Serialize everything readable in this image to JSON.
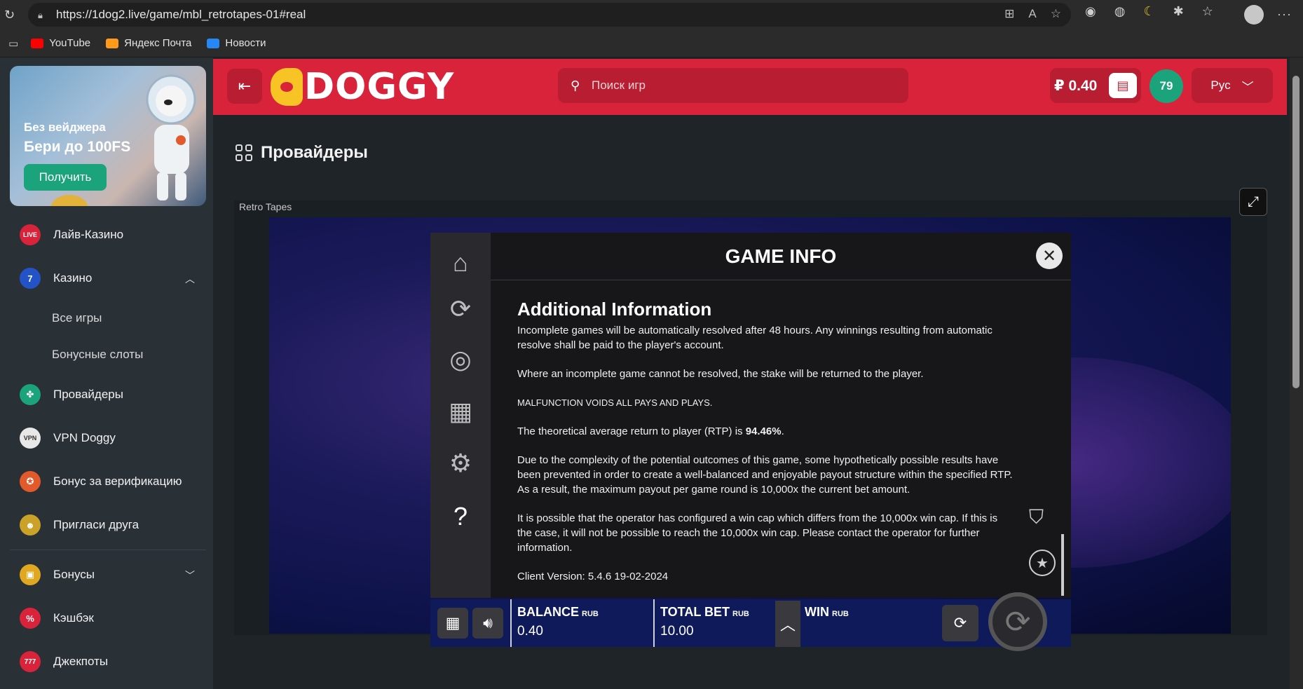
{
  "browser": {
    "url": "https://1dog2.live/game/mbl_retrotapes-01#real",
    "bookmarks": [
      {
        "label": "YouTube",
        "color": "#ff0000"
      },
      {
        "label": "Яндекс Почта",
        "color": "#ff9a1a"
      },
      {
        "label": "Новости",
        "color": "#2787f5"
      }
    ]
  },
  "promo": {
    "line1": "Без вейджера",
    "line2": "Бери до 100FS",
    "button": "Получить"
  },
  "sidebar": {
    "items": [
      {
        "label": "Лайв-Казино",
        "icon": "live-icon",
        "color": "#d8233b"
      },
      {
        "label": "Казино",
        "icon": "seven-icon",
        "color": "#2453c7"
      },
      {
        "label": "Провайдеры",
        "icon": "clover-icon",
        "color": "#1ba37c"
      },
      {
        "label": "VPN Doggy",
        "icon": "vpn-icon",
        "color": "#e8e8e8"
      },
      {
        "label": "Бонус за верификацию",
        "icon": "badge-icon",
        "color": "#e25a2b"
      },
      {
        "label": "Пригласи друга",
        "icon": "friends-icon",
        "color": "#c9a227"
      },
      {
        "label": "Бонусы",
        "icon": "gift-icon",
        "color": "#e0a820"
      },
      {
        "label": "Кэшбэк",
        "icon": "percent-icon",
        "color": "#d8233b"
      },
      {
        "label": "Джекпоты",
        "icon": "jackpot-icon",
        "color": "#d8233b"
      }
    ],
    "casino_sub": [
      "Все игры",
      "Бонусные слоты"
    ]
  },
  "header": {
    "logo": "DOGGY",
    "search_placeholder": "Поиск игр",
    "balance": "₽ 0.40",
    "level": "79",
    "language": "Рус"
  },
  "main": {
    "title": "Провайдеры",
    "game_label": "Retro Tapes"
  },
  "game_info": {
    "title": "GAME INFO",
    "heading": "Additional Information",
    "p1": "Incomplete games will be automatically resolved after 48 hours. Any winnings resulting from automatic resolve shall be paid to the player's account.",
    "p2": "Where an incomplete game cannot be resolved, the stake will be returned to the player.",
    "p3": "MALFUNCTION VOIDS ALL PAYS AND PLAYS.",
    "p4_prefix": "The theoretical average return to player (RTP) is ",
    "rtp": "94.46%",
    "p4_suffix": ".",
    "p5": "Due to the complexity of the potential outcomes of this game, some hypothetically possible results have been prevented in order to create a well-balanced and enjoyable payout structure within the specified RTP. As a result, the maximum payout per game round is 10,000x the current bet amount.",
    "p6": "It is possible that the operator has configured a win cap which differs from the 10,000x win cap. If this is the case, it will not be possible to reach the 10,000x win cap. Please contact the operator for further information.",
    "client_version": "Client Version: 5.4.6 19-02-2024"
  },
  "gamebar": {
    "balance_label": "BALANCE",
    "balance_currency": "RUB",
    "balance_value": "0.40",
    "bet_label": "TOTAL BET",
    "bet_currency": "RUB",
    "bet_value": "10.00",
    "win_label": "WIN",
    "win_currency": "RUB"
  }
}
